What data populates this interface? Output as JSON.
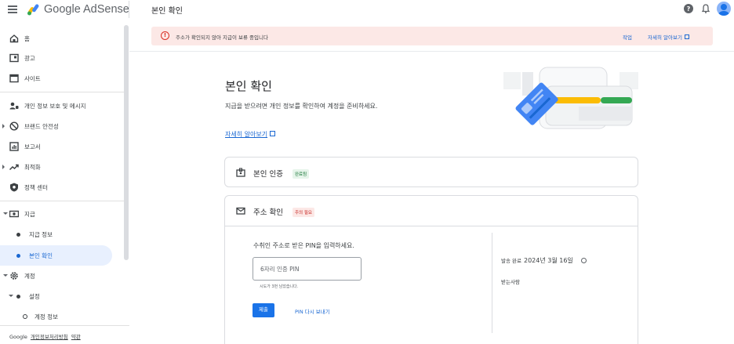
{
  "header": {
    "brand": "Google AdSense",
    "page_title": "본인 확인"
  },
  "sidebar": {
    "items": [
      {
        "label": "홈"
      },
      {
        "label": "광고"
      },
      {
        "label": "사이트"
      },
      {
        "label": "개인 정보 보호 및 메시지"
      },
      {
        "label": "브랜드 안전성"
      },
      {
        "label": "보고서"
      },
      {
        "label": "최적화"
      },
      {
        "label": "정책 센터"
      },
      {
        "label": "지급"
      },
      {
        "label": "지급 정보"
      },
      {
        "label": "본인 확인"
      },
      {
        "label": "계정"
      },
      {
        "label": "설정"
      },
      {
        "label": "계정 정보"
      }
    ],
    "footer": {
      "google": "Google",
      "privacy": "개인정보처리방침",
      "terms": "약관"
    }
  },
  "alert": {
    "text": "주소가 확인되지 않아 지급이 보류 중입니다",
    "action": "작업",
    "learn_more": "자세히 알아보기"
  },
  "main": {
    "title": "본인 확인",
    "subtitle": "지급을 받으려면 개인 정보를 확인하여 계정을 준비하세요.",
    "learn_more": "자세히 알아보기",
    "identity_card": {
      "title": "본인 인증",
      "status": "완료됨"
    },
    "address_card": {
      "title": "주소 확인",
      "status": "주의 필요",
      "pin_prompt": "수취인 주소로 받은 PIN을 입력하세요.",
      "pin_placeholder": "6자리 인증 PIN",
      "attempts_hint": "시도가 3번 남았습니다.",
      "submit": "제출",
      "resend": "PIN 다시 보내기",
      "sent_label": "발송 완료",
      "sent_date": "2024년 3월 16일",
      "recipient_label": "받는사람"
    }
  },
  "colors": {
    "accent": "#1a73e8",
    "alert_bg": "#fce8e6",
    "error": "#d93025",
    "success_chip": "#e6f4ea",
    "active_nav": "#e8f0fe"
  }
}
